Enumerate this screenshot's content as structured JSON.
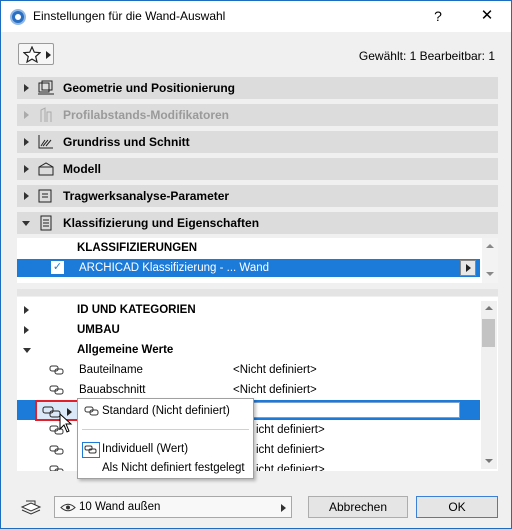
{
  "window": {
    "title": "Einstellungen für die Wand-Auswahl",
    "help": "?",
    "close": "✕"
  },
  "toolbar": {
    "selection_info": "Gewählt: 1 Bearbeitbar: 1"
  },
  "panels": [
    {
      "label": "Geometrie und Positionierung",
      "icon": "geometry-icon",
      "expanded": false,
      "disabled": false
    },
    {
      "label": "Profilabstands-Modifikatoren",
      "icon": "profile-modifier-icon",
      "expanded": false,
      "disabled": true
    },
    {
      "label": "Grundriss und Schnitt",
      "icon": "floorplan-section-icon",
      "expanded": false,
      "disabled": false
    },
    {
      "label": "Modell",
      "icon": "model-icon",
      "expanded": false,
      "disabled": false
    },
    {
      "label": "Tragwerksanalyse-Parameter",
      "icon": "structural-analysis-icon",
      "expanded": false,
      "disabled": false
    },
    {
      "label": "Klassifizierung und Eigenschaften",
      "icon": "classification-icon",
      "expanded": true,
      "disabled": false
    }
  ],
  "classification": {
    "header": "KLASSIFIZIERUNGEN",
    "row_text": "ARCHICAD Klassifizierung - ... Wand",
    "checked": true
  },
  "properties": {
    "groups": [
      {
        "label": "ID UND KATEGORIEN"
      },
      {
        "label": "UMBAU"
      },
      {
        "label": "Allgemeine Werte"
      }
    ],
    "rows": [
      {
        "name": "Bauteilname",
        "value": "<Nicht definiert>"
      },
      {
        "name": "Bauabschnitt",
        "value": "<Nicht definiert>"
      },
      {
        "name": "",
        "value": ""
      },
      {
        "name": "",
        "value": "<Nicht definiert>"
      },
      {
        "name": "",
        "value": "<Nicht definiert>"
      },
      {
        "name": "",
        "value": "<Nicht definiert>"
      }
    ],
    "value_tail": "icht definiert>"
  },
  "popup": {
    "items": [
      {
        "label": "Standard (Nicht definiert)"
      },
      {
        "label": "Individuell (Wert)"
      },
      {
        "label": "Als Nicht definiert festgelegt"
      }
    ]
  },
  "footer": {
    "layer": "10 Wand außen",
    "cancel": "Abbrechen",
    "ok": "OK"
  },
  "colors": {
    "selection": "#1c7ad8",
    "highlight_box": "#e0202a"
  }
}
